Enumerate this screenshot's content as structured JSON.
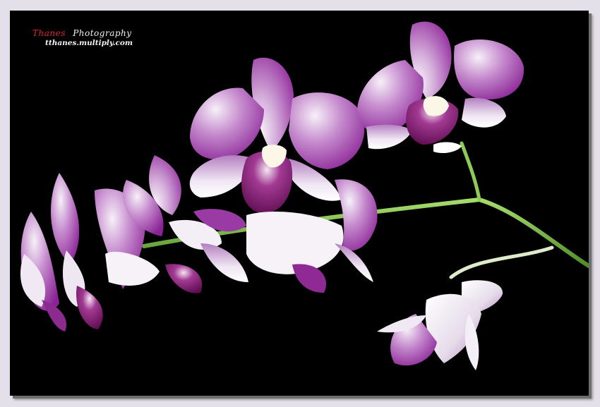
{
  "watermark": {
    "name": "Thanes",
    "word": "Photography",
    "url": "tthanes.multiply.com"
  },
  "colors": {
    "background": "#000000",
    "petal_purple": "#9a2fa0",
    "petal_white": "#f3eef6",
    "lip_magenta": "#7a1466",
    "stem_green": "#6fb23a",
    "page_border": "#e4e0ea"
  }
}
